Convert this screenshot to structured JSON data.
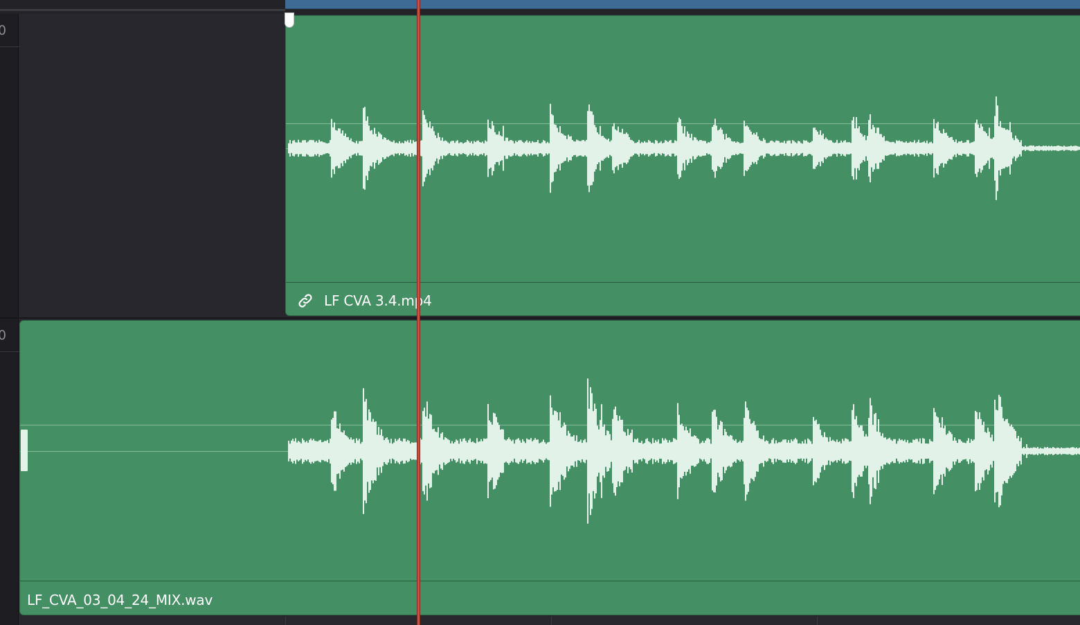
{
  "tracks": [
    {
      "number": "0",
      "clip_name": "LF CVA 3.4.mp4",
      "linked": true
    },
    {
      "number": "0",
      "clip_name": "LF_CVA_03_04_24_MIX.wav",
      "linked": false
    }
  ],
  "colors": {
    "audio_clip": "#458f64",
    "video_clip": "#3e6a96",
    "playhead": "#cf4f3f",
    "waveform": "#e2f2e8",
    "background": "#27272d"
  },
  "icons": {
    "link": "link-icon",
    "in_handle": "trim-handle-icon"
  }
}
